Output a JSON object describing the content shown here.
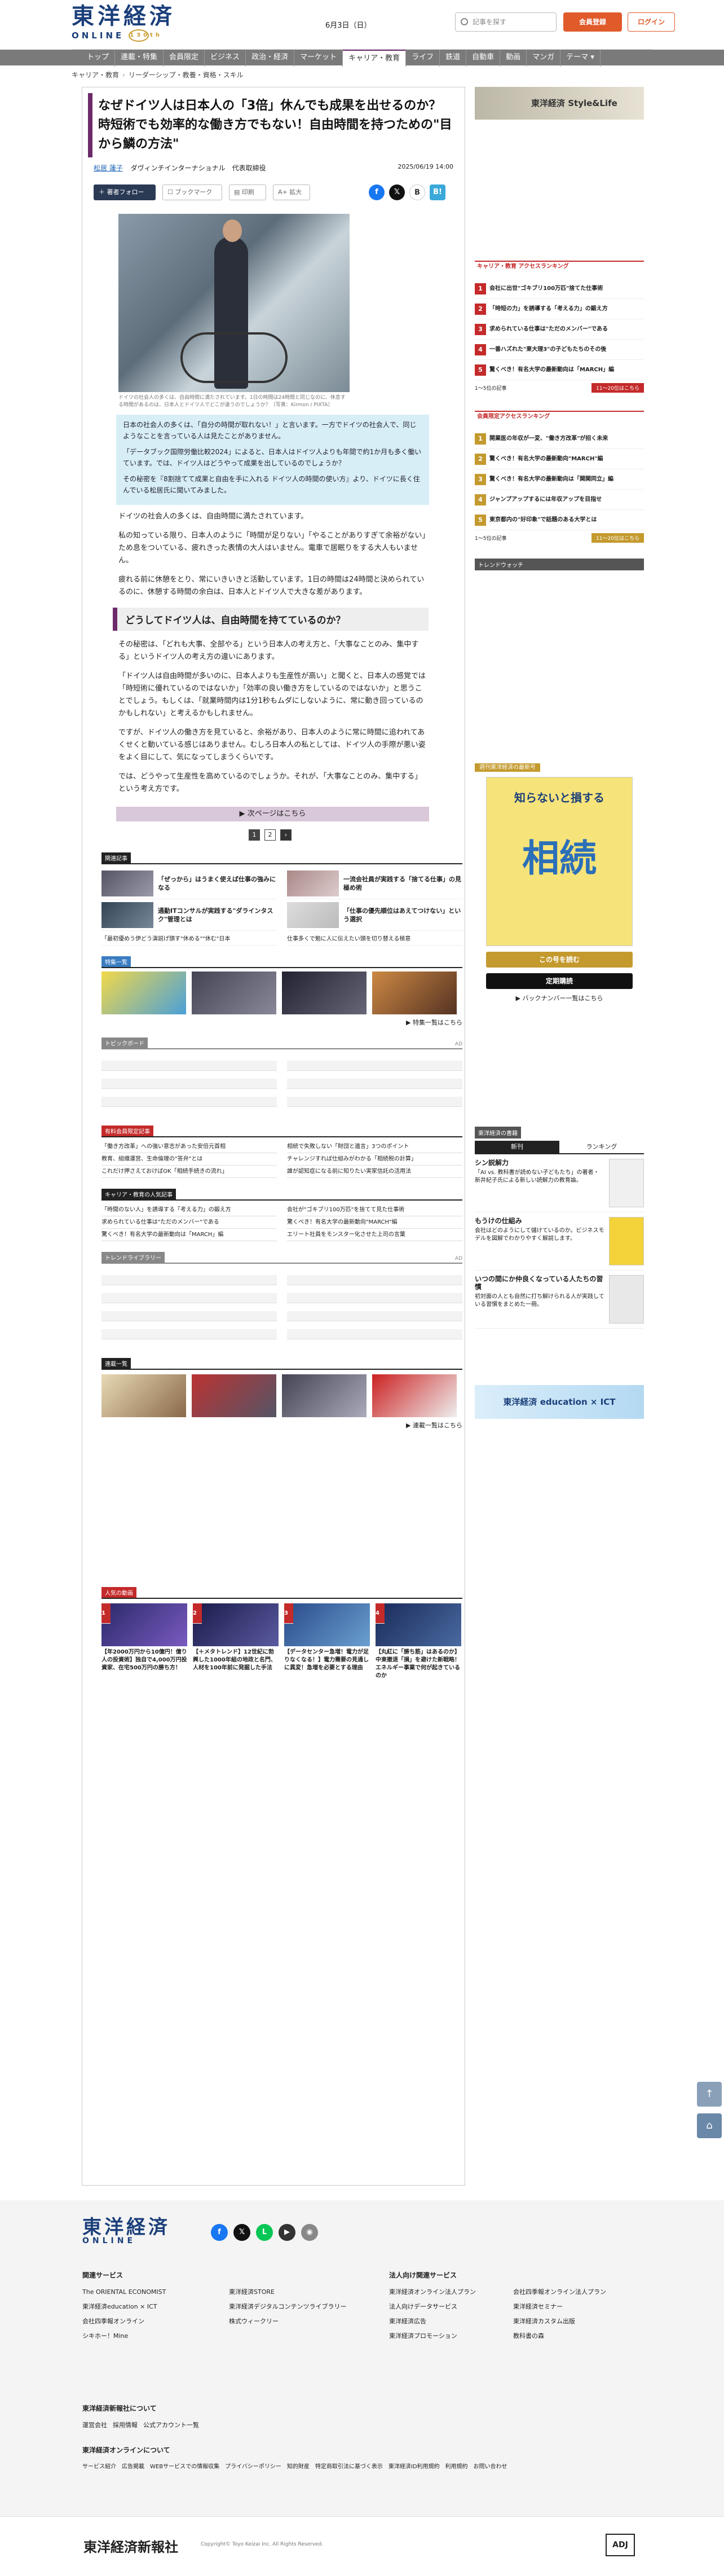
{
  "header": {
    "logo_jp": "東洋経済",
    "logo_en": "ONLINE",
    "logo_anniv": "130th",
    "date": "6月3日（日）",
    "search_placeholder": "記事を探す",
    "register": "会員登録",
    "login": "ログイン"
  },
  "nav": [
    "トップ",
    "連載・特集",
    "会員限定",
    "ビジネス",
    "政治・経済",
    "マーケット",
    "キャリア・教育",
    "ライフ",
    "鉄道",
    "自動車",
    "動画",
    "マンガ",
    "テーマ ▾"
  ],
  "breadcrumb": [
    "キャリア・教育",
    "リーダーシップ・教養・資格・スキル"
  ],
  "article": {
    "title": "なぜドイツ人は日本人の「3倍」休んでも成果を出せるのか？時短術でも効率的な働き方でもない！自由時間を持つための\"目から鱗の方法\"",
    "author": "松居 蓮子",
    "author_role": "ダヴィンチインターナショナル　代表取締役",
    "date": "2025/06/19 14:00",
    "follow": "著者フォロー",
    "bookmark": "ブックマーク",
    "print": "印刷",
    "fontsize": "A+ 拡大",
    "photo_caption": "ドイツの社会人の多くは、自由時間に満たされています。1日の時間は24時間と同じなのに、休息する時間があるのは、日本人とドイツ人でどこが違うのでしょうか？（写真：Kirmon / PIXTA）",
    "summary": [
      "日本の社会人の多くは、「自分の時間が取れない！」と言います。一方でドイツの社会人で、同じようなことを言っている人は見たことがありません。",
      "「データブック国際労働比較2024」によると、日本人はドイツ人よりも年間で約1か月も多く働いています。では、ドイツ人はどうやって成果を出しているのでしょうか？",
      "その秘密を『8割捨てて成果と自由を手に入れる ドイツ人の時間の使い方』より、ドイツに長く住んでいる松居氏に聞いてみました。"
    ],
    "summary_link": "8割捨てて成果と自由を手に入れる ドイツ人の時間の使い方",
    "paras1": [
      "ドイツの社会人の多くは、自由時間に満たされています。",
      "私の知っている限り、日本人のように「時間が足りない」「やることがありすぎて余裕がない」ため息をついている、疲れきった表情の大人はいません。電車で居眠りをする大人もいません。",
      "疲れる前に休憩をとり、常にいきいきと活動しています。1日の時間は24時間と決められているのに、休憩する時間の余白は、日本人とドイツ人で大きな差があります。"
    ],
    "h2": "どうしてドイツ人は、自由時間を持てているのか？",
    "paras2": [
      "その秘密は、「どれも大事、全部やる」という日本人の考え方と、「大事なことのみ、集中する」というドイツ人の考え方の違いにあります。",
      "「ドイツ人は自由時間が多いのに、日本人よりも生産性が高い」と聞くと、日本人の感覚では「時短術に優れているのではないか」「効率の良い働き方をしているのではないか」と思うことでしょう。もしくは、「就業時間内は1分1秒もムダにしないように、常に動き回っているのかもしれない」と考えるかもしれません。",
      "ですが、ドイツ人の働き方を見ていると、余裕があり、日本人のように常に時間に追われてあくせくと動いている感じはありません。むしろ日本人の私としては、ドイツ人の手際が悪い姿をよく目にして、気になってしまうくらいです。",
      "では、どうやって生産性を高めているのでしょうか。それが、「大事なことのみ、集中する」という考え方です。"
    ],
    "next_page": "次ページはこちら",
    "pages": [
      "1",
      "2",
      "›"
    ]
  },
  "related": {
    "label": "関連記事",
    "items": [
      "「ぜっから」はうまく使えば仕事の強みになる",
      "一流会社員が実践する「捨てる仕事」の見極め術",
      "通勤ITコンサルが実践する\"ダラインタスク\"管理とは",
      "「仕事の優先順位はあえてつけない」という選択"
    ],
    "plain": [
      "「最初優めう伊どう演説げ頭す\"休める\"\"休む\"日本",
      "仕事多くで勉に人に伝えたい頭を切り替える極意"
    ]
  },
  "feature": {
    "label": "特集一覧",
    "more": "特集一覧はこちら"
  },
  "topic": {
    "label": "トピックボード",
    "more": "AD"
  },
  "member": {
    "label": "有料会員限定記事",
    "items": [
      "「働き方改革」への強い意志があった安倍元首相",
      "相続で失敗しない「財団と遺言」3つのポイント",
      "教育、組織運営、生命倫理の\"答弁\"とは",
      "チャレンジすれば仕組みがわかる「相続税の計算」",
      "これだけ押さえておけばOK「相続手続きの流れ」",
      "誰が認知症になる前に知りたい実家信託の活用法"
    ]
  },
  "career_pop": {
    "label": "キャリア・教育の人気記事",
    "items": [
      "「時間のない人」を誘導する「考える力」の鍛え方",
      "会社が\"ゴキブリ100万匹\"を捨てて見た仕事術",
      "求められている仕事は\"ただのメンバー\"である",
      "驚くべき！有名大学の最新動向\"MARCH\"編",
      "驚くべき！有名大学の最新動向は「MARCH」編",
      "エリート社員をモンスター化させた上司の言葉"
    ]
  },
  "trend": {
    "label": "トレンドライブラリー",
    "more": "AD"
  },
  "series": {
    "label": "連載一覧",
    "more": "連載一覧はこちら"
  },
  "popular": {
    "label": "人気の動画",
    "items": [
      "【年2000万円から10億円！億り人の投資術】独自で4,000万円投資家、在宅500万円の勝ち方！",
      "【＋メタトレンド】12世紀に勃興した1000年組の地政と名門、人材を100年前に発掘した手法",
      "【データセンター急増！電力が足りなくなる！】電力需要の見通しに異変！急増を必要とする理由",
      "【丸紅に「勝ち筋」はあるのか】中東撤退「損」を避けた新戦略！エネルギー事業で何が起きているのか"
    ]
  },
  "side": {
    "ad_top": "東洋経済 Style&Life",
    "rank1_hd": "キャリア・教育 アクセスランキング",
    "rank1": [
      "会社に出世\"ゴキブリ100万匹\"捨てた仕事術",
      "「時短の力」を誘導する「考える力」の鍛え方",
      "求められている仕事は\"ただのメンバー\"である",
      "一番ハズれた\"東大理3\"の子どもたちのその後",
      "驚くべき！有名大学の最新動向は「MARCH」編"
    ],
    "rank1_ft": "1～5位の記事",
    "rank1_btn": "11～20位はこちら",
    "rank2_hd": "会員限定アクセスランキング",
    "rank2": [
      "開業医の年収が一変、\"働き方改革\"が招く未来",
      "驚くべき！有名大学の最新動向\"MARCH\"編",
      "驚くべき！有名大学の最新動向は「関関同立」編",
      "ジャンプアップするには年収アップを目指せ",
      "東京都内の\"好印象\"で話題のある大学とは"
    ],
    "rank2_btn": "11～20位はこちら",
    "trend_watch": "トレンドウォッチ",
    "weekly_hd": "週刊東洋経済の最新号",
    "weekly_date": "6/7号",
    "book_top": "知らないと損する",
    "book_title": "相続",
    "buy": "この号を読む",
    "sub": "定期購読",
    "backnum": "バックナンバー一覧はこちら",
    "books_hd": "東洋経済の書籍",
    "tabs": [
      "新刊",
      "ランキング"
    ],
    "books": [
      {
        "t": "シン説解力",
        "d": "「AI vs. 教科書が読めない子どもたち」の著者・新井紀子氏による新しい読解力の教育論。"
      },
      {
        "t": "もうけの仕組み",
        "d": "会社はどのようにして儲けているのか。ビジネスモデルを図解でわかりやすく解説します。"
      },
      {
        "t": "いつの間にか仲良くなっている人たちの習慣",
        "d": "初対面の人とも自然に打ち解けられる人が実践している習慣をまとめた一冊。"
      }
    ],
    "ad_bottom": "東洋経済 education × ICT"
  },
  "footer": {
    "logo_jp": "東洋経済",
    "logo_en": "ONLINE",
    "col1_hd": "関連サービス",
    "col1": [
      "The ORIENTAL ECONOMIST",
      "東洋経済education × ICT",
      "会社四季報オンライン",
      "シキホー！Mine"
    ],
    "col2": [
      "東洋経済STORE",
      "東洋経済デジタルコンテンツライブラリー",
      "株式ウィークリー"
    ],
    "col3_hd": "法人向け関連サービス",
    "col3": [
      "東洋経済オンライン法人プラン",
      "法人向けデータサービス",
      "東洋経済広告",
      "東洋経済プロモーション"
    ],
    "col4": [
      "会社四季報オンライン法人プラン",
      "東洋経済セミナー",
      "東洋経済カスタム出版",
      "教科書の森"
    ],
    "about_hd": "東洋経済新報社について",
    "about": [
      "運営会社",
      "採用情報",
      "公式アカウント一覧"
    ],
    "site_hd": "東洋経済オンラインについて",
    "site": [
      "サービス紹介",
      "広告掲載",
      "WEBサービスでの情報収集",
      "プライバシーポリシー",
      "知的財産",
      "特定商取引法に基づく表示",
      "東洋経済ID利用規約",
      "利用規約",
      "お問い合わせ"
    ],
    "corp": "東洋経済新報社",
    "copy": "Copyright© Toyo Keizai Inc. All Rights Reserved.",
    "adj": "ADJ"
  },
  "colors": {
    "accent": "#6c2a6a",
    "brand": "#1b3f7a",
    "orange": "#e05a2a",
    "red": "#c42a2a"
  }
}
